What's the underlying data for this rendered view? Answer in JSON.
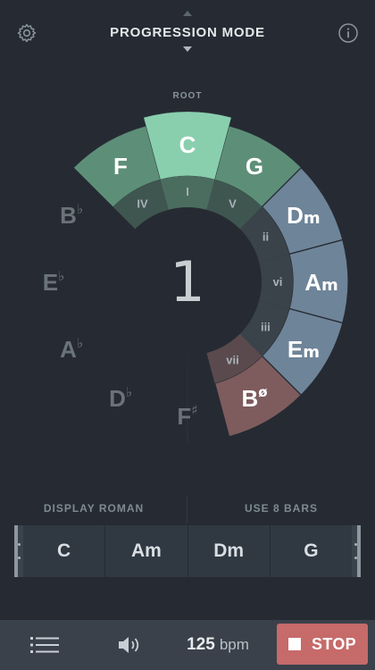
{
  "header": {
    "mode_title": "PROGRESSION MODE"
  },
  "wheel": {
    "root_label": "ROOT",
    "center_number": "1",
    "outer_keys": [
      "C",
      "G",
      "D",
      "A",
      "E",
      "B",
      "F",
      "D",
      "A",
      "E",
      "B",
      "F"
    ],
    "outer_suffix": [
      "",
      "",
      "m",
      "m",
      "m",
      "ø",
      "♯",
      "♭",
      "♭",
      "♭",
      "♭",
      ""
    ],
    "inner_numerals": [
      "I",
      "V",
      "ii",
      "vi",
      "iii",
      "vii",
      "",
      "",
      "",
      "",
      "",
      "IV"
    ]
  },
  "options": {
    "left_label": "DISPLAY ROMAN",
    "right_label": "USE 8 BARS"
  },
  "progression": {
    "chords": [
      "C",
      "Am",
      "Dm",
      "G"
    ]
  },
  "bottom": {
    "bpm_value": "125",
    "bpm_unit": "bpm",
    "stop_label": "STOP"
  },
  "colors": {
    "background": "#262b33",
    "ring_base": "#333b40",
    "major_green": "#5d8f78",
    "root_mint": "#89cfae",
    "minor_blue": "#6e8499",
    "dim_red": "#7e5c5e",
    "stop_red": "#c66a6a"
  }
}
